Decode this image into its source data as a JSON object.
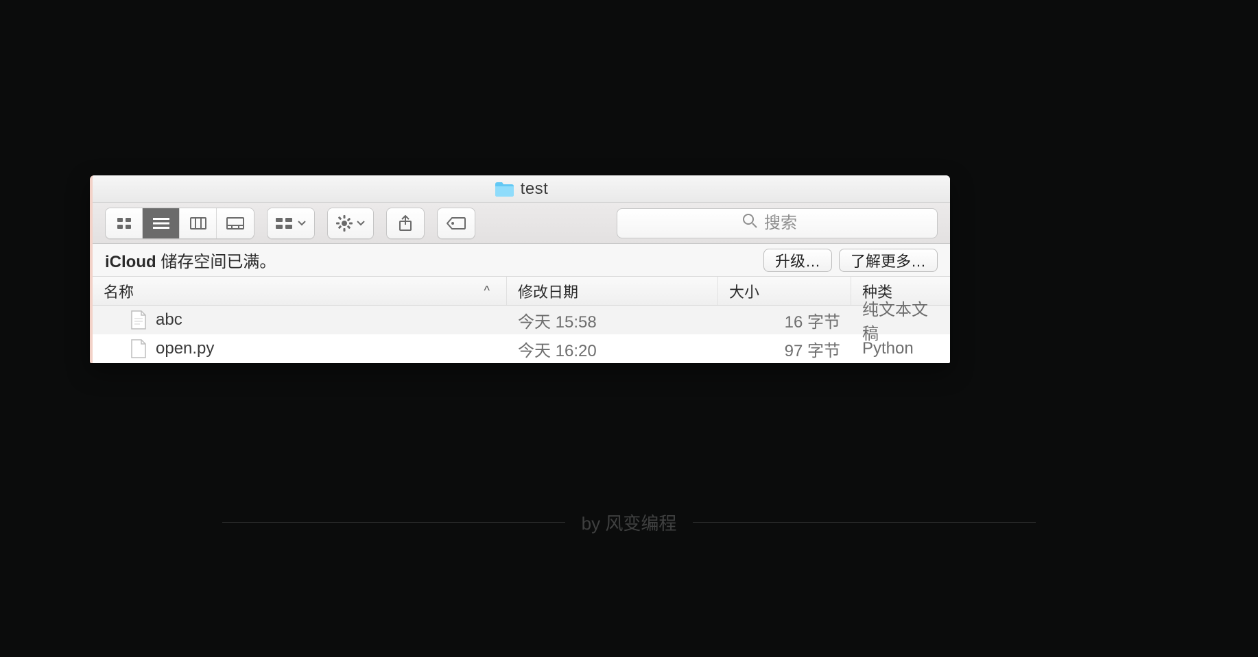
{
  "window": {
    "title": "test",
    "folder_icon": "folder-icon"
  },
  "toolbar": {
    "view_icon": "icon-view",
    "view_list": "list-view",
    "view_column": "column-view",
    "view_gallery": "gallery-view",
    "arrange": "arrange",
    "action": "action-gear",
    "share": "share",
    "tags": "tags"
  },
  "search": {
    "placeholder": "搜索"
  },
  "banner": {
    "strong": "iCloud",
    "rest": " 储存空间已满。",
    "upgrade": "升级…",
    "learn_more": "了解更多…"
  },
  "columns": {
    "name": "名称",
    "date": "修改日期",
    "size": "大小",
    "kind": "种类",
    "sort_indicator": "^"
  },
  "files": [
    {
      "name": "abc",
      "date": "今天 15:58",
      "size": "16 字节",
      "kind": "纯文本文稿"
    },
    {
      "name": "open.py",
      "date": "今天 16:20",
      "size": "97 字节",
      "kind": "Python"
    }
  ],
  "footer": {
    "text": "by 风变编程"
  }
}
